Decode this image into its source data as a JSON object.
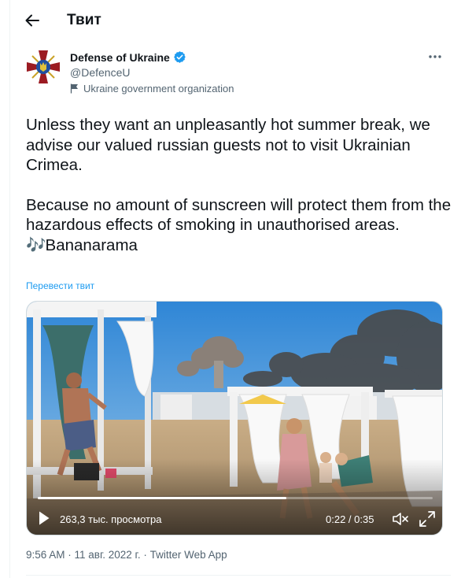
{
  "header": {
    "title": "Твит",
    "back_icon": "arrow-left-icon"
  },
  "author": {
    "name": "Defense of Ukraine",
    "handle": "@DefenceU",
    "verified": true,
    "affiliation": "Ukraine government organization",
    "avatar_icon": "ministry-of-defence-emblem"
  },
  "tweet": {
    "paragraph1": "Unless they want an unpleasantly hot summer break, we advise our valued russian guests not to visit Ukrainian Crimea.",
    "paragraph2": "Because no amount of sunscreen will protect them from the hazardous effects of smoking in unauthorised areas.",
    "emoji": "🎶",
    "song": "Bananarama",
    "translate_label": "Перевести твит"
  },
  "video": {
    "views": "263,3 тыс. просмотра",
    "time": "0:22 / 0:35",
    "progress": 0.63
  },
  "meta": {
    "time": "9:56 AM",
    "separator1": " · ",
    "date": "11 авг. 2022 г.",
    "separator2": " · ",
    "source": "Twitter Web App"
  },
  "colors": {
    "accent": "#1d9bf0",
    "text": "#0f1419",
    "secondary": "#536471",
    "verified": "#1d9bf0"
  }
}
